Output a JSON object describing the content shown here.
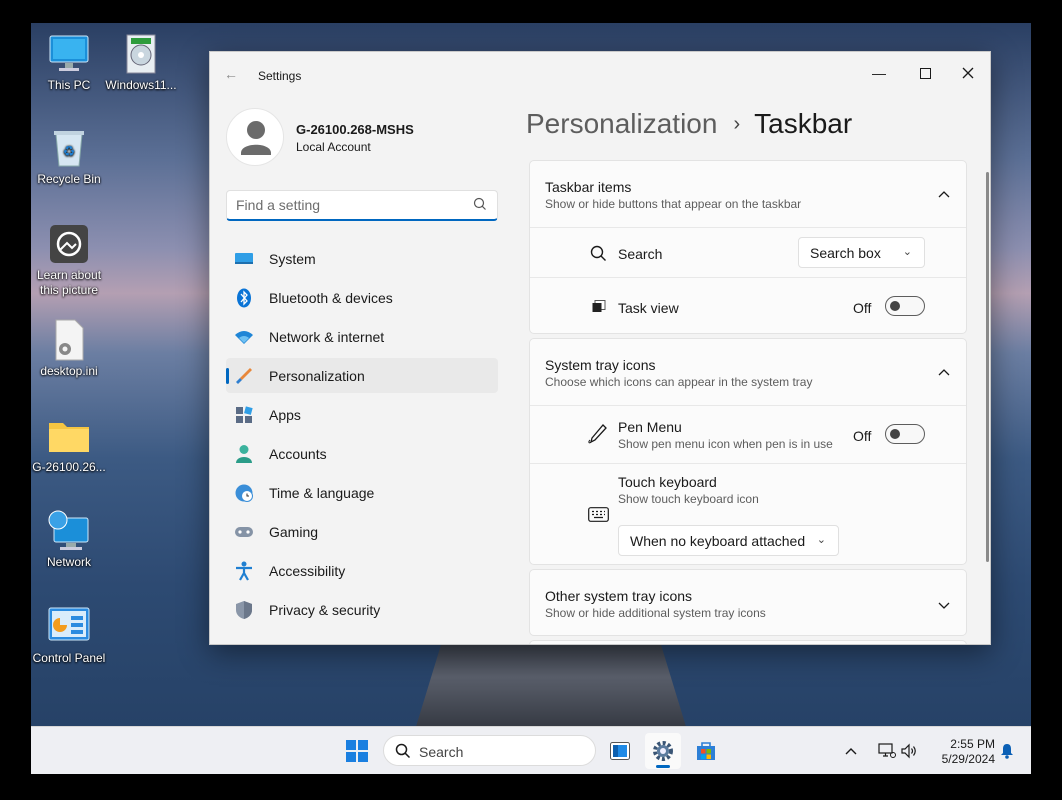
{
  "desktop": {
    "icons": [
      {
        "label": "This PC"
      },
      {
        "label": "Windows11..."
      },
      {
        "label": "Recycle Bin"
      },
      {
        "label": "Learn about this picture"
      },
      {
        "label": "desktop.ini"
      },
      {
        "label": "G-26100.26..."
      },
      {
        "label": "Network"
      },
      {
        "label": "Control Panel"
      }
    ]
  },
  "settings": {
    "title": "Settings",
    "account": {
      "name": "G-26100.268-MSHS",
      "type": "Local Account"
    },
    "search_placeholder": "Find a setting",
    "nav": [
      {
        "label": "System",
        "icon": "system-icon"
      },
      {
        "label": "Bluetooth & devices",
        "icon": "bluetooth-icon"
      },
      {
        "label": "Network & internet",
        "icon": "wifi-icon"
      },
      {
        "label": "Personalization",
        "icon": "brush-icon",
        "selected": true
      },
      {
        "label": "Apps",
        "icon": "apps-icon"
      },
      {
        "label": "Accounts",
        "icon": "person-icon"
      },
      {
        "label": "Time & language",
        "icon": "clock-globe-icon"
      },
      {
        "label": "Gaming",
        "icon": "gamepad-icon"
      },
      {
        "label": "Accessibility",
        "icon": "accessibility-icon"
      },
      {
        "label": "Privacy & security",
        "icon": "shield-icon"
      }
    ],
    "breadcrumb": {
      "parent": "Personalization",
      "separator": "›",
      "current": "Taskbar"
    },
    "taskbar_items": {
      "title": "Taskbar items",
      "subtitle": "Show or hide buttons that appear on the taskbar",
      "search": {
        "label": "Search",
        "value": "Search box"
      },
      "task_view": {
        "label": "Task view",
        "state": "Off"
      }
    },
    "system_tray": {
      "title": "System tray icons",
      "subtitle": "Choose which icons can appear in the system tray",
      "pen_menu": {
        "label": "Pen Menu",
        "sub": "Show pen menu icon when pen is in use",
        "state": "Off"
      },
      "touch_keyboard": {
        "label": "Touch keyboard",
        "sub": "Show touch keyboard icon",
        "value": "When no keyboard attached"
      }
    },
    "other_tray": {
      "title": "Other system tray icons",
      "subtitle": "Show or hide additional system tray icons"
    }
  },
  "taskbar": {
    "search_label": "Search",
    "time": "2:55 PM",
    "date": "5/29/2024"
  },
  "colors": {
    "accent": "#0067c0",
    "window_bg": "#f3f3f3",
    "card_bg": "#fbfbfb"
  }
}
